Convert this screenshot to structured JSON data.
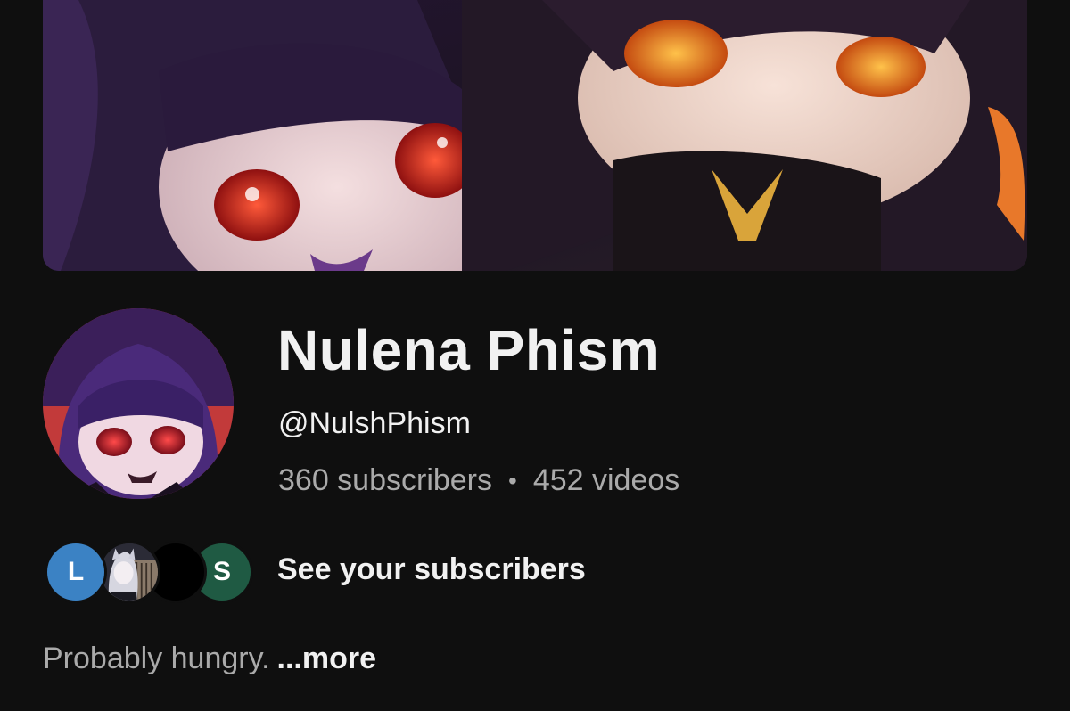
{
  "channel": {
    "name": "Nulena Phism",
    "handle": "@NulshPhism",
    "subscribers": "360 subscribers",
    "separator": "•",
    "videos": "452 videos"
  },
  "subscribers_preview": {
    "avatars": [
      {
        "initial": "L",
        "color": "#3b82c4"
      },
      {
        "initial": "",
        "color": "#2b2b36"
      },
      {
        "initial": "",
        "color": "#000000"
      },
      {
        "initial": "S",
        "color": "#1f5a43"
      }
    ],
    "label": "See your subscribers"
  },
  "description": {
    "text": "Probably hungry.",
    "more_label": "...more"
  },
  "colors": {
    "background": "#0f0f0f",
    "primary_text": "#f1f1f1",
    "secondary_text": "#aaaaaa"
  }
}
